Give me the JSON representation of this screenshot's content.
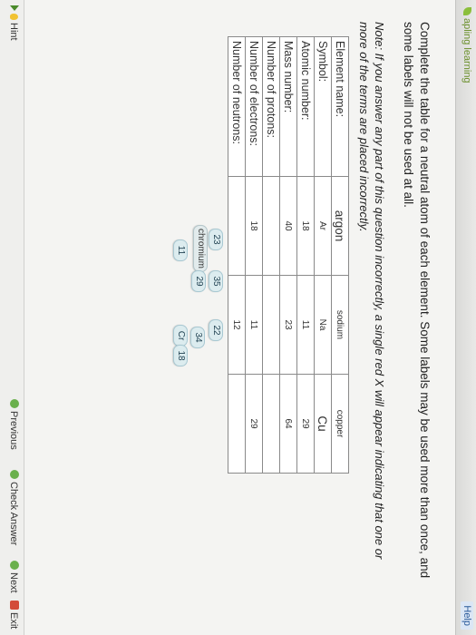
{
  "app": {
    "brand": "apling learning",
    "help_label": "Help"
  },
  "question": {
    "instructions": "Complete the table for a neutral atom of each element. Some labels may be used more than once, and some labels will not be used at all.",
    "note": "Note: If you answer any part of this question incorrectly, a single red X will appear indicating that one or more of the terms are placed incorrectly."
  },
  "table": {
    "row_headers": [
      "Element name:",
      "Symbol:",
      "Atomic number:",
      "Mass number:",
      "Number of protons:",
      "Number of electrons:",
      "Number of neutrons:"
    ],
    "columns": [
      {
        "element_name": "argon",
        "symbol": "Ar",
        "atomic_number": "18",
        "mass_number": "40",
        "protons": "",
        "electrons": "18",
        "neutrons": ""
      },
      {
        "element_name": "sodium",
        "symbol": "Na",
        "atomic_number": "11",
        "mass_number": "23",
        "protons": "",
        "electrons": "11",
        "neutrons": "12"
      },
      {
        "element_name": "copper",
        "symbol": "Cu",
        "atomic_number": "29",
        "mass_number": "64",
        "protons": "",
        "electrons": "29",
        "neutrons": ""
      }
    ]
  },
  "labels": {
    "chromium": "chromium",
    "cr": "Cr",
    "n11": "11",
    "n18": "18",
    "n34": "34",
    "n29": "29",
    "n23": "23",
    "n35": "35",
    "n22": "22"
  },
  "footer": {
    "hint": "Hint",
    "previous": "Previous",
    "check_answer": "Check Answer",
    "next": "Next",
    "exit": "Exit"
  }
}
